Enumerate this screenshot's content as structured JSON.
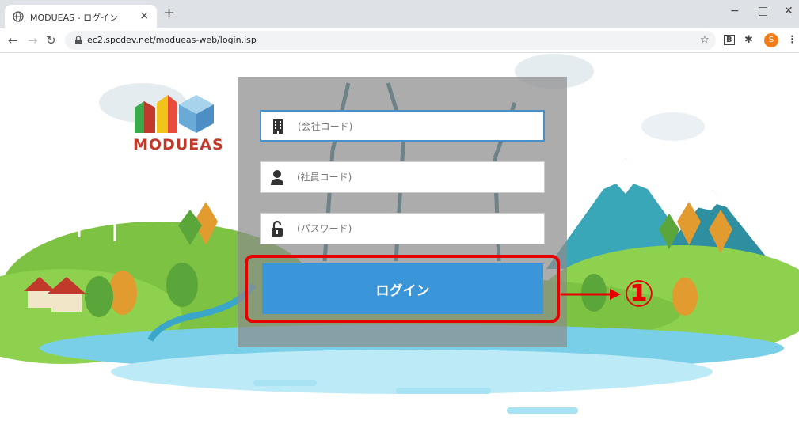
{
  "browser": {
    "tab_title": "MODUEAS - ログイン",
    "tab_close": "×",
    "new_tab": "+",
    "window_minimize": "−",
    "window_maximize": "□",
    "window_close": "✕",
    "url": "ec2.spcdev.net/modueas-web/login.jsp",
    "profile_initial": "S"
  },
  "logo": {
    "text": "MODUEAS"
  },
  "form": {
    "company_placeholder": "(会社コード)",
    "employee_placeholder": "(社員コード)",
    "password_placeholder": "(パスワード)",
    "login_label": "ログイン"
  },
  "annotation": {
    "callout": "①"
  },
  "colors": {
    "accent": "#3b95d9",
    "highlight": "#e60000",
    "panel": "#8c8c8c",
    "profile": "#f27d19"
  }
}
